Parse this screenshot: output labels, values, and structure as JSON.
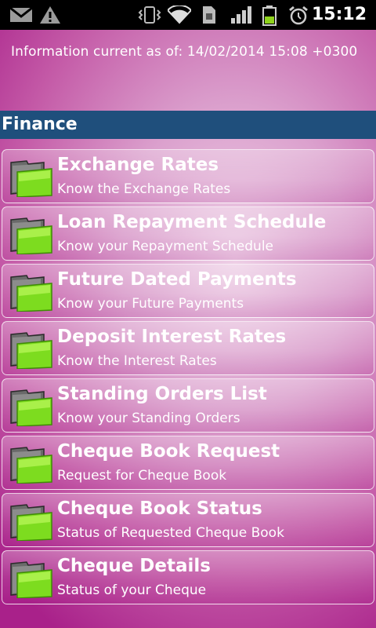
{
  "status_bar": {
    "time": "15:12",
    "icons": [
      "mail-icon",
      "warning-icon",
      "vibrate-icon",
      "wifi-icon",
      "sim-icon",
      "signal-icon",
      "battery-icon",
      "alarm-icon"
    ]
  },
  "info_text": "Information current as of: 14/02/2014 15:08 +0300",
  "section": {
    "title": "Finance"
  },
  "items": [
    {
      "title": "Exchange Rates",
      "subtitle": "Know the Exchange Rates"
    },
    {
      "title": "Loan Repayment Schedule",
      "subtitle": "Know your Repayment Schedule"
    },
    {
      "title": "Future Dated Payments",
      "subtitle": "Know your Future Payments"
    },
    {
      "title": "Deposit Interest Rates",
      "subtitle": "Know the Interest Rates"
    },
    {
      "title": "Standing Orders List",
      "subtitle": "Know your Standing Orders"
    },
    {
      "title": "Cheque Book Request",
      "subtitle": "Request for Cheque Book"
    },
    {
      "title": "Cheque Book Status",
      "subtitle": "Status of Requested Cheque Book"
    },
    {
      "title": "Cheque Details",
      "subtitle": "Status of your Cheque"
    }
  ],
  "colors": {
    "header_bg": "#1f4f7c",
    "accent_green": "#7ddc1f"
  }
}
